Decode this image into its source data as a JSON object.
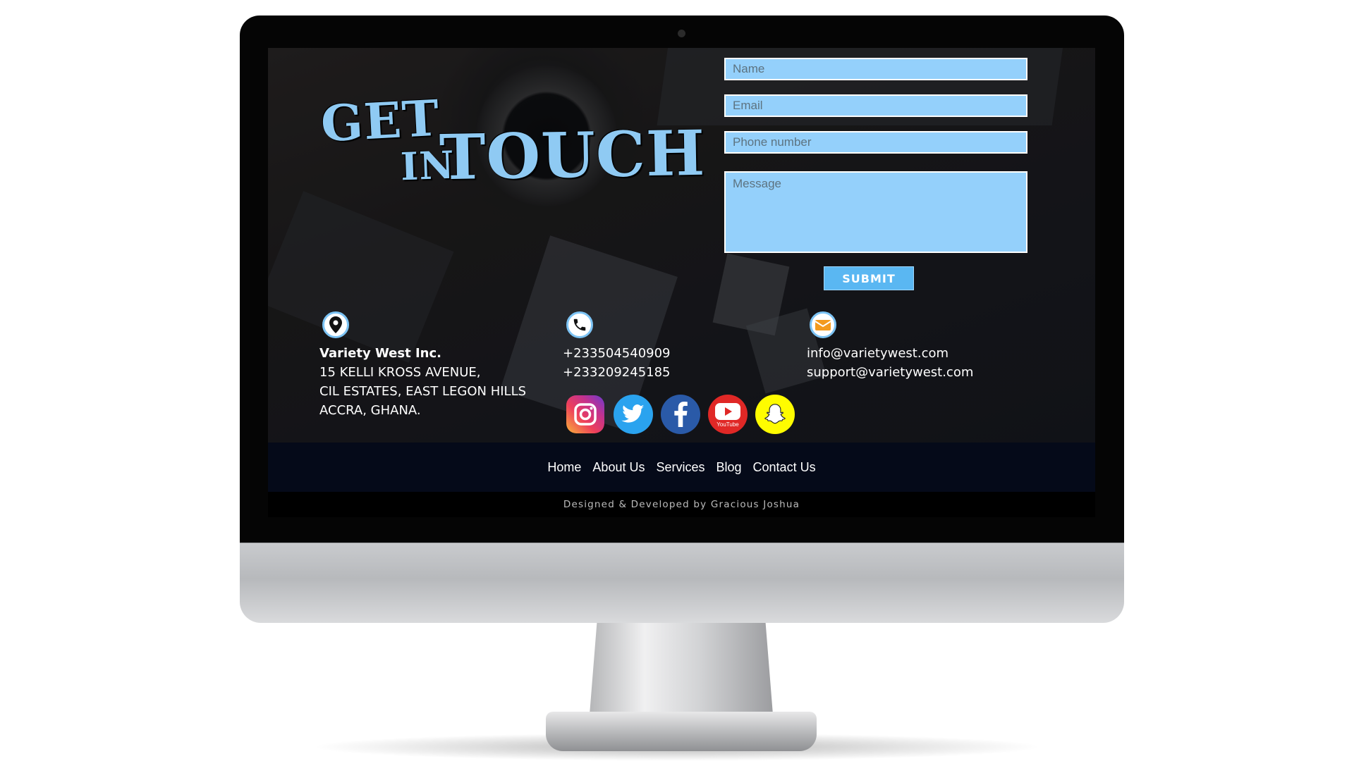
{
  "hero": {
    "title_line1": "GET",
    "title_in": "IN",
    "title_touch": "TOUCH"
  },
  "form": {
    "name_placeholder": "Name",
    "email_placeholder": "Email",
    "phone_placeholder": "Phone number",
    "message_placeholder": "Message",
    "submit_label": "SUBMIT"
  },
  "contact": {
    "company": "Variety West Inc.",
    "address_line1": "15 KELLI KROSS AVENUE,",
    "address_line2": "CIL ESTATES, EAST LEGON HILLS",
    "address_line3": "ACCRA, GHANA.",
    "phone1": "+233504540909",
    "phone2": "+233209245185",
    "email1": "info@varietywest.com",
    "email2": "support@varietywest.com"
  },
  "social": {
    "youtube_label": "YouTube",
    "icons": [
      "instagram-icon",
      "twitter-icon",
      "facebook-icon",
      "youtube-icon",
      "snapchat-icon"
    ]
  },
  "nav": {
    "home": "Home",
    "about": "About Us",
    "services": "Services",
    "blog": "Blog",
    "contact": "Contact Us"
  },
  "footer": {
    "credit": "Designed & Developed by Gracious Joshua"
  },
  "colors": {
    "accent": "#94d0fb",
    "title": "#8fcaf3",
    "submit": "#5ab7f2",
    "nav_bg": "#050a19"
  }
}
